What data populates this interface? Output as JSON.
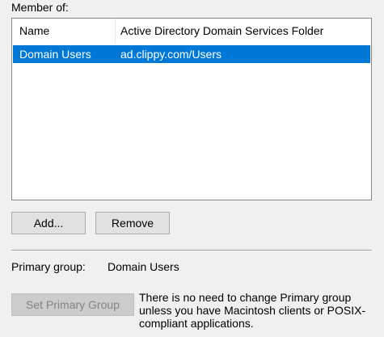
{
  "member_of": {
    "label": "Member of:",
    "columns": [
      "Name",
      "Active Directory Domain Services Folder"
    ],
    "rows": [
      {
        "name": "Domain Users",
        "folder": "ad.clippy.com/Users",
        "selected": true
      }
    ],
    "selection_color": "#0078d7"
  },
  "buttons": {
    "add": "Add...",
    "remove": "Remove",
    "set_primary": "Set Primary Group"
  },
  "primary_group": {
    "label": "Primary group:",
    "value": "Domain Users",
    "info": "There is no need to change Primary group unless you have Macintosh clients or POSIX-compliant applications."
  }
}
